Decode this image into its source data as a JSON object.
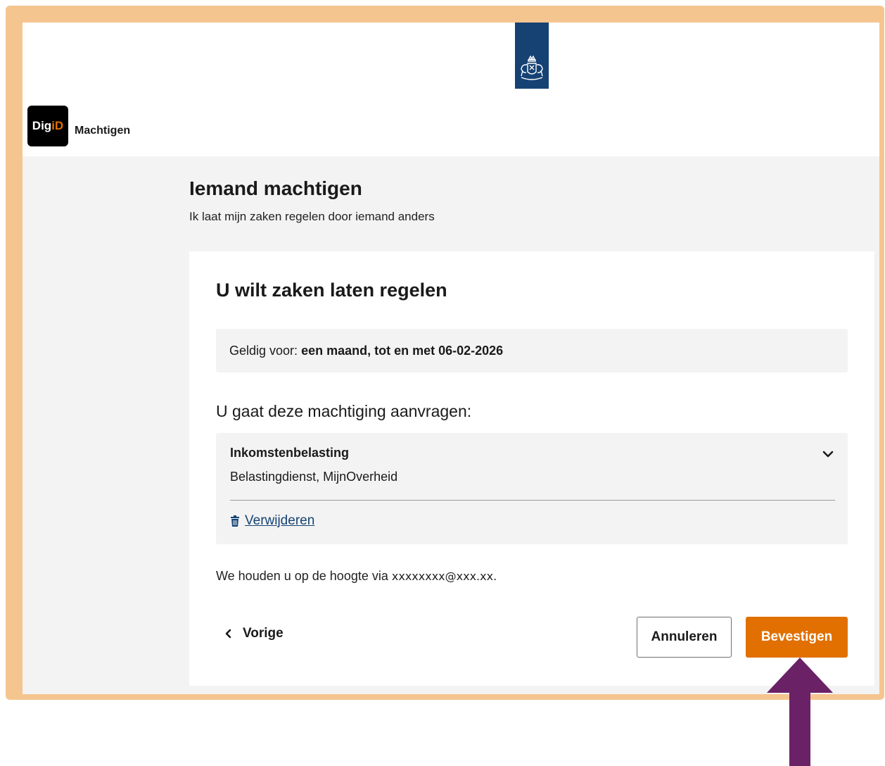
{
  "header": {
    "logo_part1": "Dig",
    "logo_part2": "iD",
    "app_name": "Machtigen"
  },
  "page": {
    "title": "Iemand machtigen",
    "subtitle": "Ik laat mijn zaken regelen door iemand anders"
  },
  "card": {
    "title": "U wilt zaken laten regelen",
    "validity_label": "Geldig voor:",
    "validity_value": "een maand, tot en met 06-02-2026",
    "request_heading": "U gaat deze machtiging aanvragen:",
    "authorization": {
      "title": "Inkomstenbelasting",
      "providers": "Belastingdienst, MijnOverheid",
      "remove_label": "Verwijderen"
    },
    "notify_prefix": "We houden u op de hoogte via",
    "notify_email": "xxxxxxxx@xxx.xx."
  },
  "actions": {
    "back_label": "Vorige",
    "cancel_label": "Annuleren",
    "confirm_label": "Bevestigen"
  },
  "colors": {
    "frame": "#f5c590",
    "primary_orange": "#e17000",
    "link_blue": "#154273",
    "rijksoverheid_blue": "#154273",
    "annotation_arrow": "#6b2166"
  },
  "icons": {
    "logo": "rijksoverheid-crest-icon",
    "accordion": "chevron-down-icon",
    "remove": "trash-icon",
    "back": "chevron-left-icon",
    "annotation": "arrow-up-icon"
  }
}
